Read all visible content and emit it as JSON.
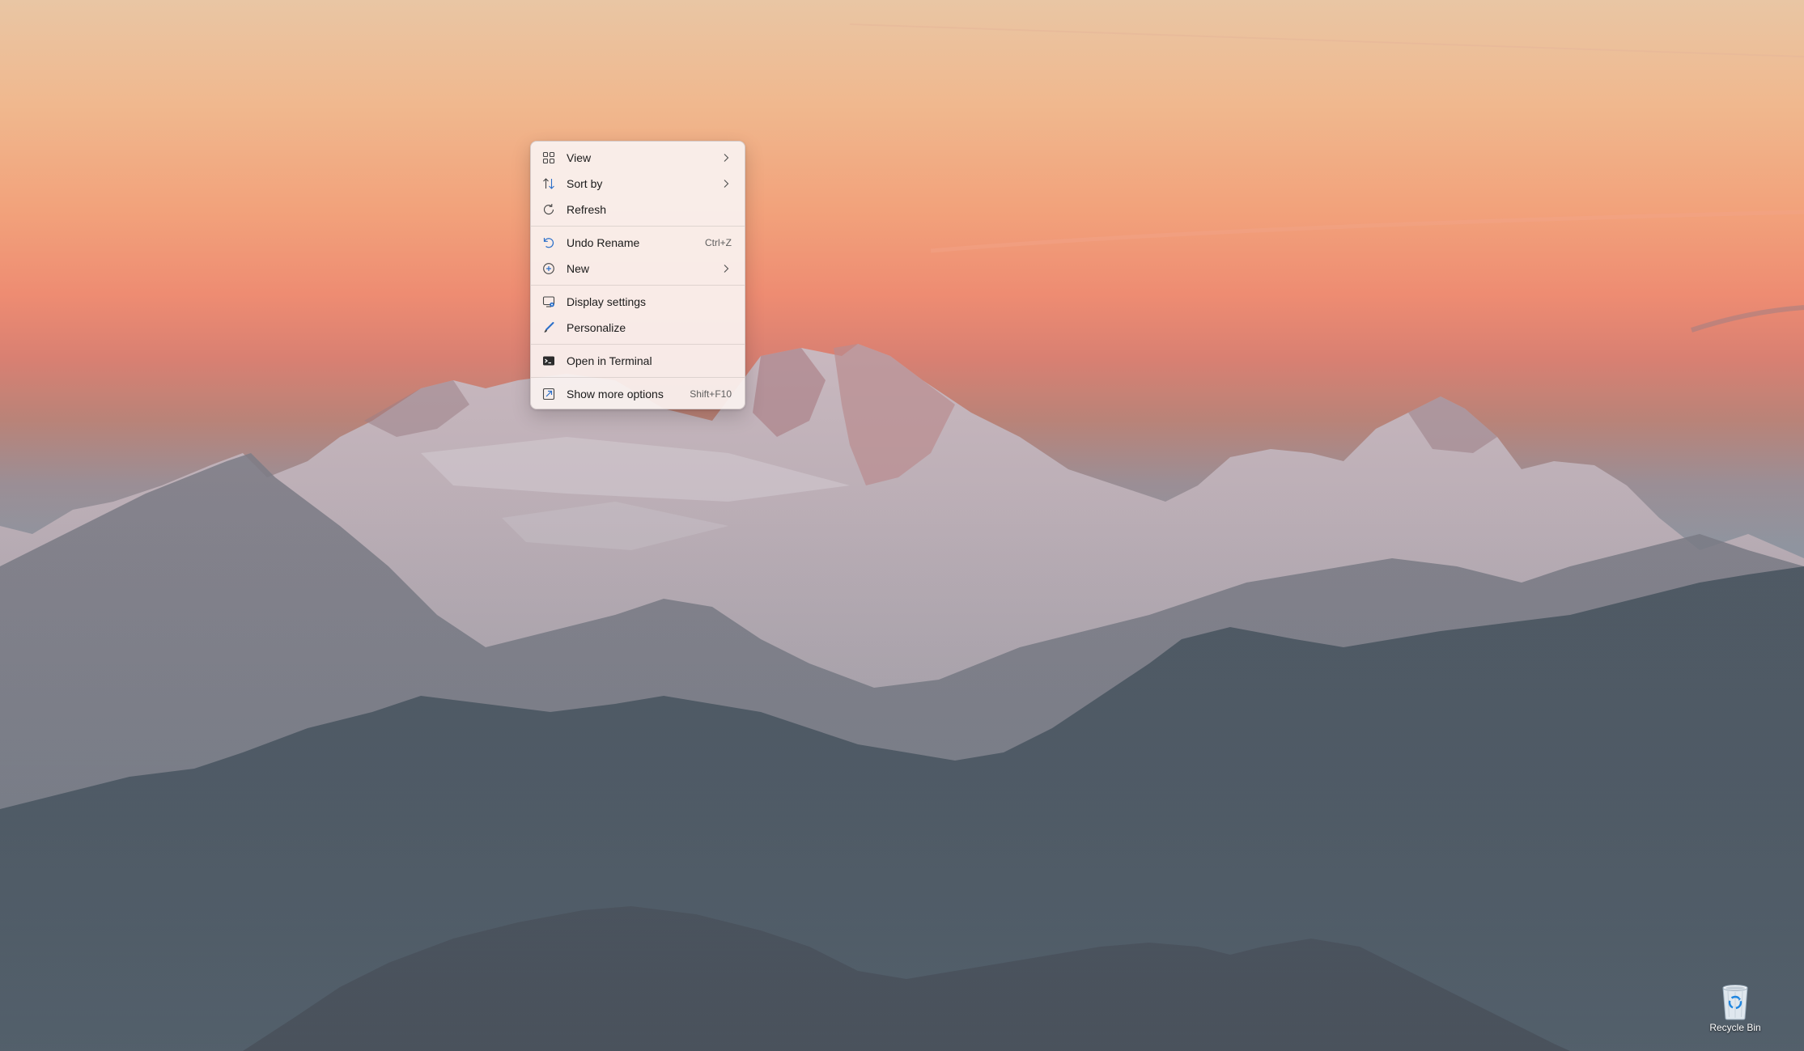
{
  "desktop": {
    "context_menu": {
      "items": [
        {
          "label": "View",
          "icon": "grid-icon",
          "has_submenu": true
        },
        {
          "label": "Sort by",
          "icon": "sort-icon",
          "has_submenu": true
        },
        {
          "label": "Refresh",
          "icon": "refresh-icon",
          "has_submenu": false
        },
        {
          "label": "Undo Rename",
          "icon": "undo-icon",
          "shortcut": "Ctrl+Z"
        },
        {
          "label": "New",
          "icon": "add-circle-icon",
          "has_submenu": true
        },
        {
          "label": "Display settings",
          "icon": "display-icon"
        },
        {
          "label": "Personalize",
          "icon": "brush-icon"
        },
        {
          "label": "Open in Terminal",
          "icon": "terminal-icon"
        },
        {
          "label": "Show more options",
          "icon": "more-options-icon",
          "shortcut": "Shift+F10"
        }
      ]
    },
    "icons": [
      {
        "label": "Recycle Bin",
        "icon": "recycle-bin-icon"
      }
    ]
  }
}
